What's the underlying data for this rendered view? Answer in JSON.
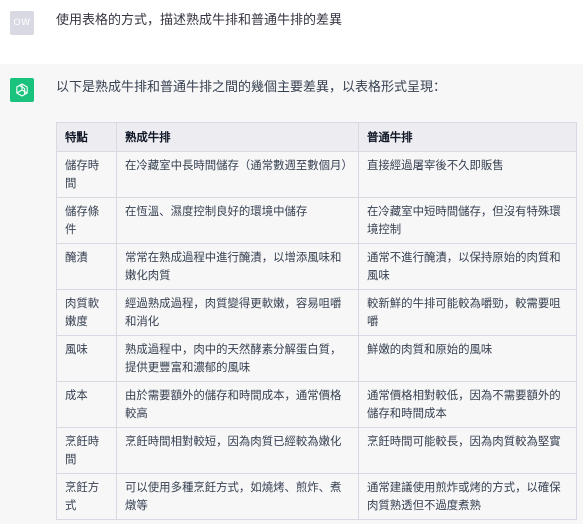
{
  "user": {
    "avatar_initials": "OW",
    "prompt": "使用表格的方式，描述熟成牛排和普通牛排的差異"
  },
  "assistant": {
    "avatar_icon": "openai-logo-icon",
    "intro": "以下是熟成牛排和普通牛排之間的幾個主要差異，以表格形式呈現：",
    "table": {
      "headers": [
        "特點",
        "熟成牛排",
        "普通牛排"
      ],
      "rows": [
        [
          "儲存時間",
          "在冷藏室中長時間儲存（通常數週至數個月）",
          "直接經過屠宰後不久即販售"
        ],
        [
          "儲存條件",
          "在恆溫、濕度控制良好的環境中儲存",
          "在冷藏室中短時間儲存，但沒有特殊環境控制"
        ],
        [
          "醃漬",
          "常常在熟成過程中進行醃漬，以增添風味和嫩化肉質",
          "通常不進行醃漬，以保持原始的肉質和風味"
        ],
        [
          "肉質軟嫩度",
          "經過熟成過程，肉質變得更軟嫩，容易咀嚼和消化",
          "較新鮮的牛排可能較為嚼勁，較需要咀嚼"
        ],
        [
          "風味",
          "熟成過程中，肉中的天然酵素分解蛋白質，提供更豐富和濃郁的風味",
          "鮮嫩的肉質和原始的風味"
        ],
        [
          "成本",
          "由於需要額外的儲存和時間成本，通常價格較高",
          "通常價格相對較低，因為不需要額外的儲存和時間成本"
        ],
        [
          "烹飪時間",
          "烹飪時間相對較短，因為肉質已經較為嫩化",
          "烹飪時間可能較長，因為肉質較為堅實"
        ],
        [
          "烹飪方式",
          "可以使用多種烹飪方式，如燒烤、煎炸、煮燉等",
          "通常建議使用煎炸或烤的方式，以確保肉質熟透但不過度煮熟"
        ]
      ]
    }
  }
}
